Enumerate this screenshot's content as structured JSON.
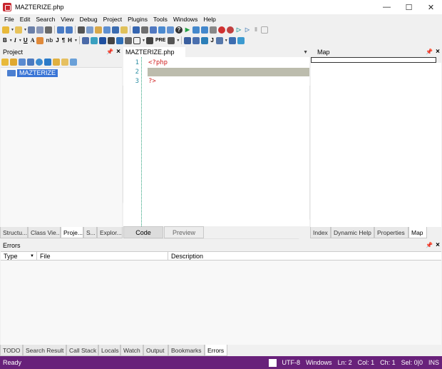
{
  "window": {
    "title": "MAZTERIZE.php"
  },
  "menu": [
    "File",
    "Edit",
    "Search",
    "View",
    "Debug",
    "Project",
    "Plugins",
    "Tools",
    "Windows",
    "Help"
  ],
  "toolbar2_text": {
    "bold": "B",
    "italic": "I",
    "underline": "U",
    "font": "A",
    "nb": "nb",
    "j": "J",
    "p": "¶",
    "h": "H",
    "pre": "PRE",
    "j2": "J"
  },
  "project_panel": {
    "title": "Project",
    "tree_item": "MAZTERIZE"
  },
  "left_tabs": [
    "Structu...",
    "Class Vie...",
    "Proje...",
    "S...",
    "Explor..."
  ],
  "editor": {
    "tab_title": "MAZTERIZE.php",
    "line_numbers": [
      "1",
      "2",
      "3"
    ],
    "lines": [
      "<?php",
      "",
      "?>"
    ],
    "code_tab": "Code",
    "preview_tab": "Preview"
  },
  "right_panel": {
    "title": "Map"
  },
  "right_tabs": [
    "Index",
    "Dynamic Help",
    "Properties",
    "Map"
  ],
  "errors_panel": {
    "title": "Errors",
    "columns": [
      "Type",
      "File",
      "Description"
    ]
  },
  "bottom_tabs": [
    "TODO",
    "Search Result",
    "Call Stack",
    "Locals",
    "Watch",
    "Output",
    "Bookmarks",
    "Errors"
  ],
  "status": {
    "ready": "Ready",
    "encoding": "UTF-8",
    "line_ending": "Windows",
    "ln": "Ln: 2",
    "col": "Col: 1",
    "ch": "Ch: 1",
    "sel": "Sel: 0|0",
    "mode": "INS"
  },
  "colors": {
    "statusbar": "#68217a",
    "selection": "#3a75d6",
    "current_line": "#bcbcad",
    "php_tag": "#d02020"
  }
}
